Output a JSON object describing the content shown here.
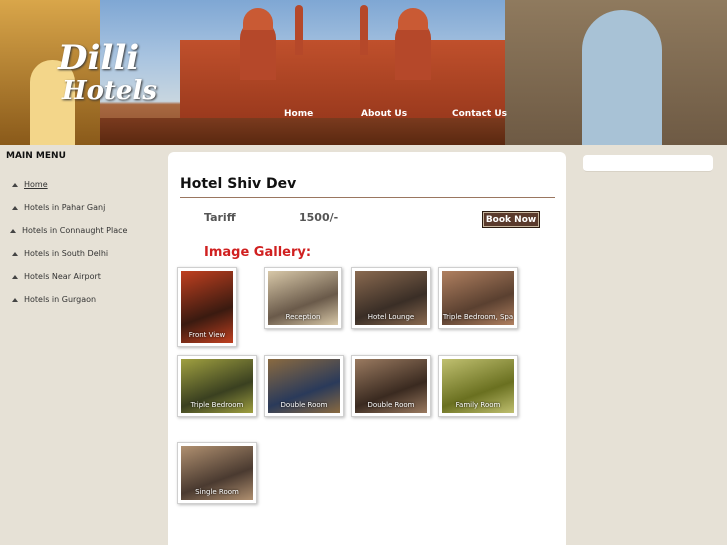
{
  "header": {
    "logo_line1": "Dilli",
    "logo_line2": "Hotels",
    "nav": [
      {
        "label": "Home"
      },
      {
        "label": "About Us"
      },
      {
        "label": "Contact Us"
      }
    ]
  },
  "sidebar": {
    "title": "MAIN MENU",
    "items": [
      {
        "label": "Home"
      },
      {
        "label": "Hotels in Pahar Ganj"
      },
      {
        "label": "Hotels in Connaught Place"
      },
      {
        "label": "Hotels in South Delhi"
      },
      {
        "label": "Hotels Near Airport"
      },
      {
        "label": "Hotels in Gurgaon"
      }
    ]
  },
  "main": {
    "hotel_name": "Hotel Shiv Dev",
    "tariff_label": "Tariff",
    "tariff_value": "1500/-",
    "book_button": "Book Now",
    "gallery_title": "Image Gallery:",
    "gallery": [
      {
        "caption": "Front View",
        "colors": [
          "#3a1a10",
          "#c04020"
        ]
      },
      {
        "caption": "Reception",
        "colors": [
          "#6a5a4a",
          "#d8c8a8"
        ]
      },
      {
        "caption": "Hotel Lounge",
        "colors": [
          "#3a2e26",
          "#8a6a50"
        ]
      },
      {
        "caption": "Triple Bedroom, Spa",
        "colors": [
          "#5a4030",
          "#b08060"
        ]
      },
      {
        "caption": "Triple Bedroom",
        "colors": [
          "#3a4020",
          "#a0a040"
        ]
      },
      {
        "caption": "Double Room",
        "colors": [
          "#2a3a5a",
          "#8a6a40"
        ]
      },
      {
        "caption": "Double Room",
        "colors": [
          "#3a2a20",
          "#9a7a60"
        ]
      },
      {
        "caption": "Family Room",
        "colors": [
          "#6a7020",
          "#c0c070"
        ]
      },
      {
        "caption": "Single Room",
        "colors": [
          "#4a3a30",
          "#b09070"
        ]
      }
    ]
  },
  "colors": {
    "accent_red": "#d02020",
    "button_brown": "#5a3a2c",
    "page_bg": "#e6e1d6"
  }
}
